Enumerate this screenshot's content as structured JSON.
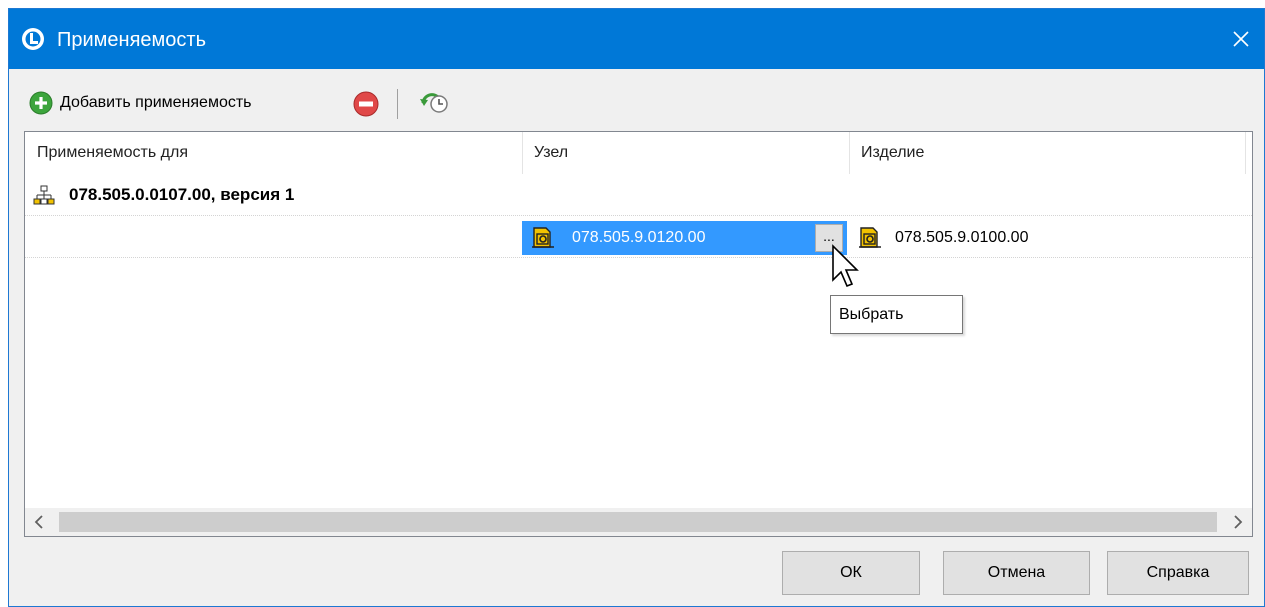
{
  "window": {
    "title": "Применяемость"
  },
  "toolbar": {
    "add_label": "Добавить применяемость"
  },
  "grid": {
    "columns": [
      "Применяемость для",
      "Узел",
      "Изделие"
    ],
    "group": {
      "label": "078.505.0.0107.00, версия 1"
    },
    "rows": [
      {
        "node": "078.505.9.0120.00",
        "node_button": "...",
        "product": "078.505.9.0100.00"
      }
    ]
  },
  "tooltip": {
    "text": "Выбрать"
  },
  "buttons": {
    "ok": "ОК",
    "cancel": "Отмена",
    "help": "Справка"
  },
  "colors": {
    "titlebar": "#0078d7",
    "selection": "#3399ff",
    "add_icon": "#3ca53c",
    "remove_icon": "#e04848"
  },
  "icons": [
    "app-logo-icon",
    "close-icon",
    "add-icon",
    "remove-icon",
    "history-icon",
    "assembly-tree-icon",
    "part-icon",
    "cursor-arrow-icon",
    "scroll-left-icon",
    "scroll-right-icon"
  ]
}
